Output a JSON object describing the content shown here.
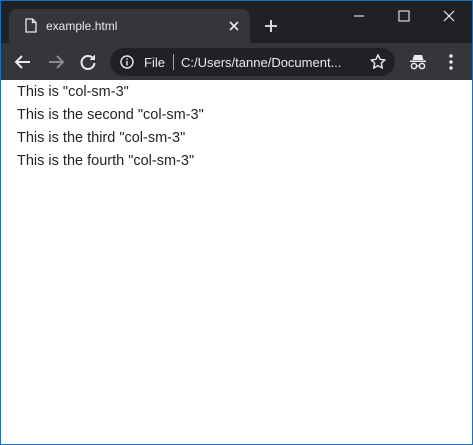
{
  "tab": {
    "title": "example.html"
  },
  "address_bar": {
    "scheme_label": "File",
    "url": "C:/Users/tanne/Document..."
  },
  "page": {
    "lines": [
      "This is \"col-sm-3\"",
      "This is the second \"col-sm-3\"",
      "This is the third \"col-sm-3\"",
      "This is the fourth \"col-sm-3\""
    ]
  },
  "colors": {
    "titlebar_bg": "#202124",
    "toolbar_bg": "#35363a",
    "omnibox_bg": "#202124",
    "window_border": "#1f6fbf",
    "text": "#212529"
  },
  "icons": {
    "favicon": "document-icon",
    "tab_close": "close-icon",
    "new_tab": "plus-icon",
    "back": "arrow-left-icon",
    "forward": "arrow-right-icon",
    "reload": "reload-icon",
    "info": "info-icon",
    "bookmark": "star-icon",
    "incognito": "incognito-icon",
    "menu": "kebab-menu-icon"
  }
}
